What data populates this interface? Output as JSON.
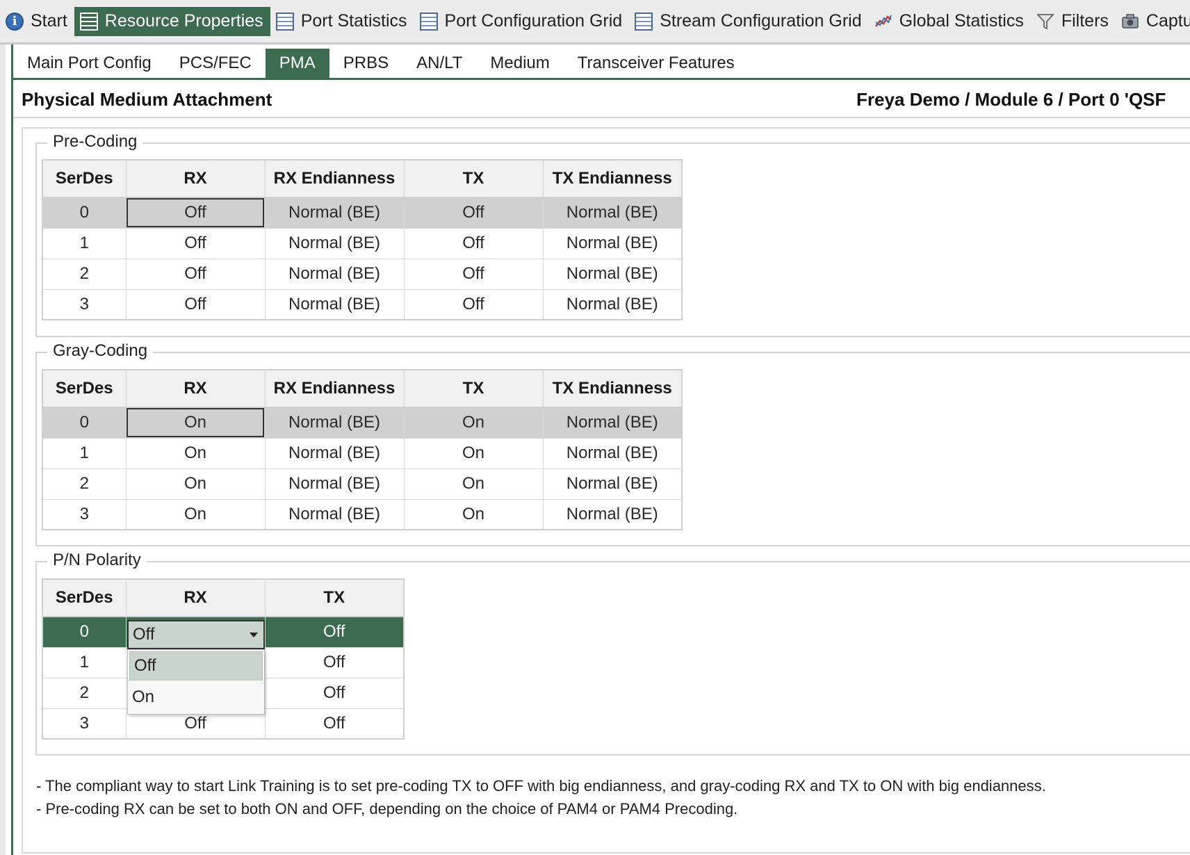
{
  "toolbar": {
    "items": [
      {
        "label": "Start",
        "icon": "info-icon"
      },
      {
        "label": "Resource Properties",
        "icon": "grid-icon",
        "active": true
      },
      {
        "label": "Port Statistics",
        "icon": "grid-icon"
      },
      {
        "label": "Port Configuration Grid",
        "icon": "grid-icon"
      },
      {
        "label": "Stream Configuration Grid",
        "icon": "grid-icon"
      },
      {
        "label": "Global Statistics",
        "icon": "chart-icon"
      },
      {
        "label": "Filters",
        "icon": "filter-icon"
      },
      {
        "label": "Capture",
        "icon": "camera-icon"
      }
    ]
  },
  "subtabs": [
    "Main Port Config",
    "PCS/FEC",
    "PMA",
    "PRBS",
    "AN/LT",
    "Medium",
    "Transceiver Features"
  ],
  "active_subtab": "PMA",
  "panel": {
    "title": "Physical Medium Attachment",
    "path": "Freya Demo / Module 6 / Port 0 'QSF"
  },
  "precoding": {
    "legend": "Pre-Coding",
    "headers": [
      "SerDes",
      "RX",
      "RX Endianness",
      "TX",
      "TX Endianness"
    ],
    "rows": [
      [
        "0",
        "Off",
        "Normal (BE)",
        "Off",
        "Normal (BE)"
      ],
      [
        "1",
        "Off",
        "Normal (BE)",
        "Off",
        "Normal (BE)"
      ],
      [
        "2",
        "Off",
        "Normal (BE)",
        "Off",
        "Normal (BE)"
      ],
      [
        "3",
        "Off",
        "Normal (BE)",
        "Off",
        "Normal (BE)"
      ]
    ]
  },
  "graycoding": {
    "legend": "Gray-Coding",
    "headers": [
      "SerDes",
      "RX",
      "RX Endianness",
      "TX",
      "TX Endianness"
    ],
    "rows": [
      [
        "0",
        "On",
        "Normal (BE)",
        "On",
        "Normal (BE)"
      ],
      [
        "1",
        "On",
        "Normal (BE)",
        "On",
        "Normal (BE)"
      ],
      [
        "2",
        "On",
        "Normal (BE)",
        "On",
        "Normal (BE)"
      ],
      [
        "3",
        "On",
        "Normal (BE)",
        "On",
        "Normal (BE)"
      ]
    ]
  },
  "polarity": {
    "legend": "P/N Polarity",
    "headers": [
      "SerDes",
      "RX",
      "TX"
    ],
    "rows": [
      [
        "0",
        "Off",
        "Off"
      ],
      [
        "1",
        "",
        "Off"
      ],
      [
        "2",
        "",
        "Off"
      ],
      [
        "3",
        "Off",
        "Off"
      ]
    ],
    "combo_value": "Off",
    "dropdown_options": [
      "Off",
      "On"
    ]
  },
  "notes": [
    "- The compliant way to start Link Training is to set pre-coding TX to OFF with big endianness, and gray-coding RX and TX to ON with big endianness.",
    "- Pre-coding RX can be set to both ON and OFF, depending on the choice of PAM4 or PAM4 Precoding."
  ],
  "colors": {
    "accent": "#3d6b4f",
    "selected_row": "#d0d0d0",
    "combo_bg": "#c8d4cc"
  }
}
